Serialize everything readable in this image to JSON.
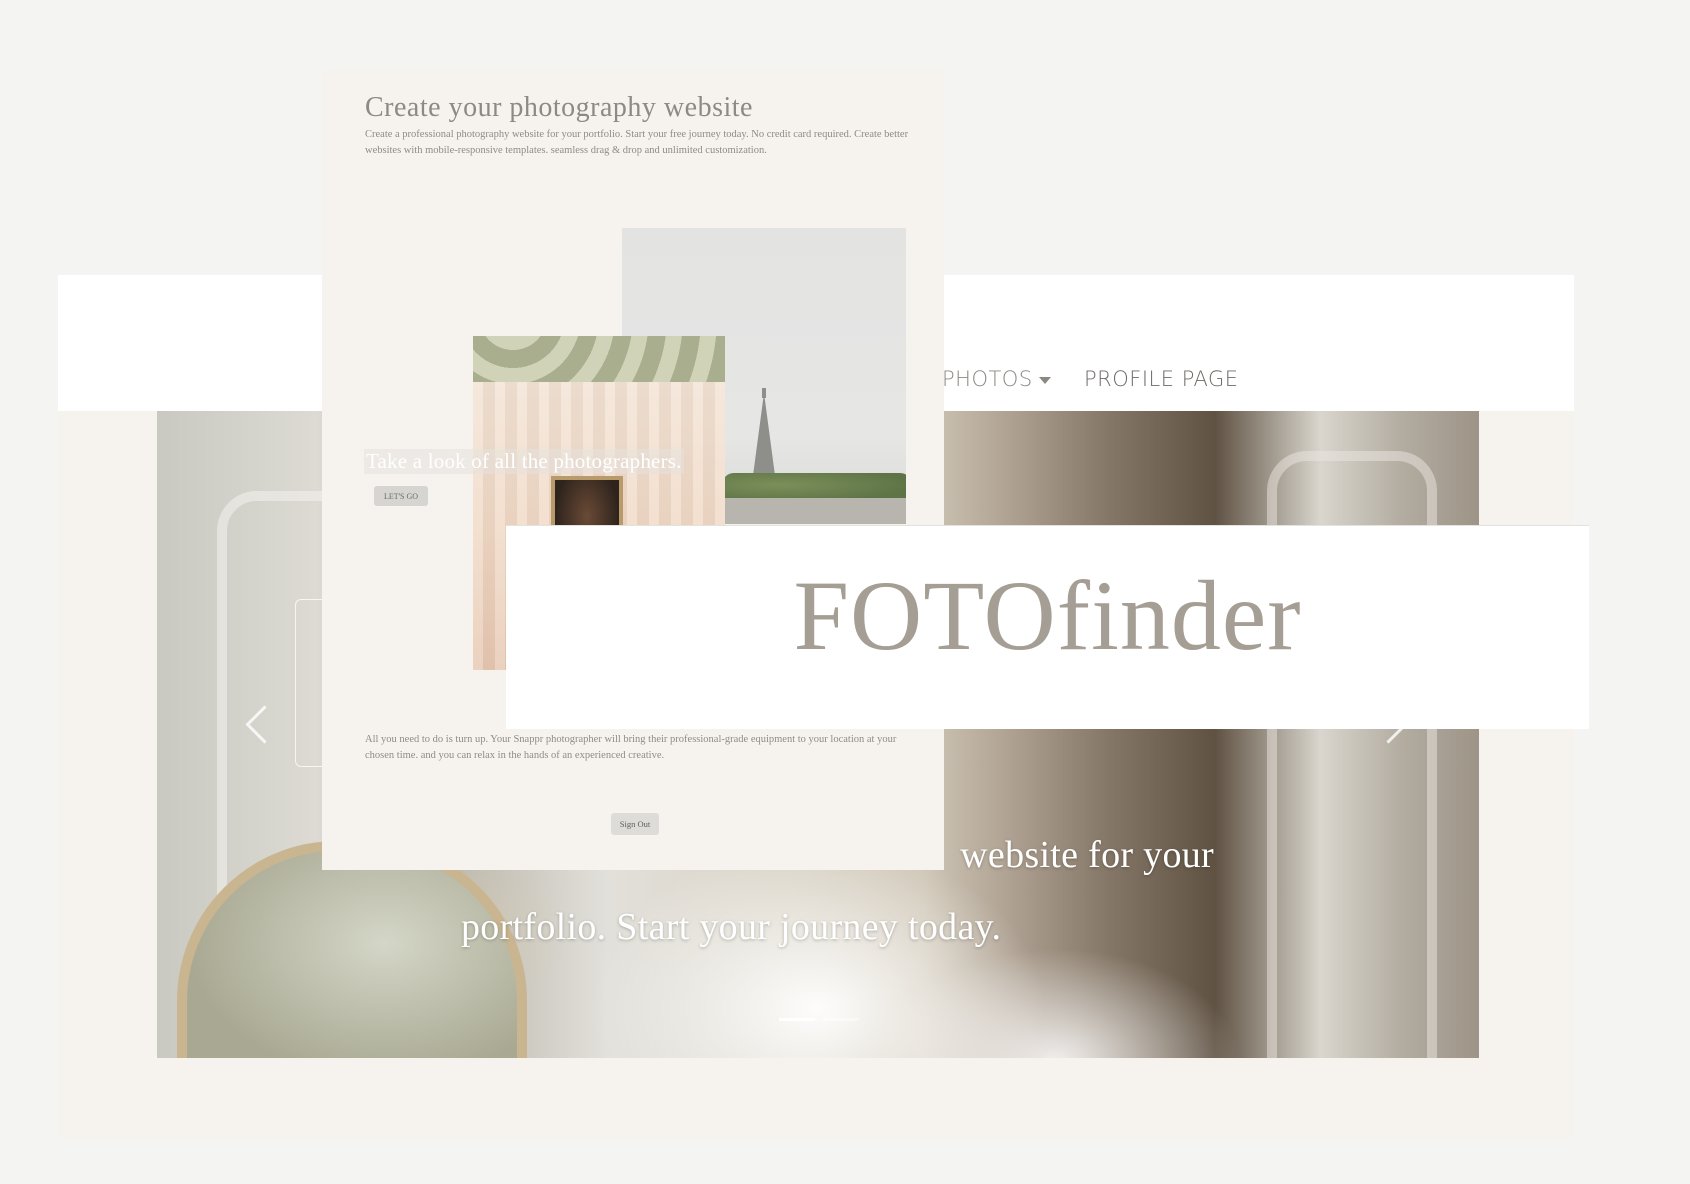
{
  "home": {
    "nav": [
      {
        "label": "PHOTOS",
        "has_dropdown": true
      },
      {
        "label": "PROFILE PAGE",
        "has_dropdown": false
      }
    ],
    "hero": {
      "caption_line1": "website for your",
      "caption_line2": "portfolio. Start your journey today.",
      "slides": 2,
      "active_slide": 1,
      "prev_icon": "chevron-left-icon",
      "next_icon": "chevron-right-icon"
    }
  },
  "signup": {
    "title": "Create your photography website",
    "description": "Create a professional photography website for your portfolio. Start your free journey today. No credit card required. Create better websites with mobile-responsive templates. seamless drag & drop and unlimited customization.",
    "photographers_label": "Take a look of all the photographers.",
    "lets_go_label": "LET'S GO",
    "note": "All you need to do is turn up. Your Snappr photographer will bring their professional-grade equipment to your location at your chosen time. and you can relax in the hands of an experienced creative.",
    "sign_out_label": "Sign Out"
  },
  "logo": {
    "text": "FOTOfinder"
  },
  "colors": {
    "page_background": "#f4f4f3",
    "panel_background": "#f6f3ef",
    "logo_text": "#a59e94",
    "nav_text": "#6e6b68"
  }
}
